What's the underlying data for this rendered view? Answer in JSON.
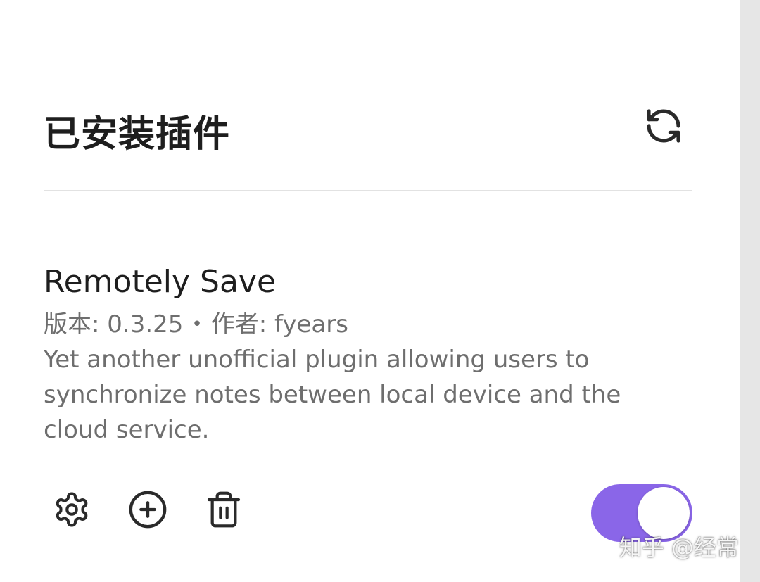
{
  "header": {
    "title": "已安装插件",
    "refresh_icon": "refresh-icon"
  },
  "plugin": {
    "name": "Remotely Save",
    "version_label": "版本: 0.3.25",
    "separator": "•",
    "author_label": "作者:  fyears",
    "description": "Yet another unofficial plugin allowing users to synchronize notes between local device and the cloud service.",
    "enabled": true,
    "actions": {
      "settings_icon": "gear-icon",
      "hotkeys_icon": "plus-circle-icon",
      "uninstall_icon": "trash-icon"
    }
  },
  "watermark": {
    "text": "知乎 @经常"
  },
  "colors": {
    "toggle_on": "#8a66e8",
    "title_text": "#1e1e1e",
    "muted_text": "#6e6e6e",
    "divider": "#e2e2e2",
    "scrollbar_track": "#e6e6e6"
  }
}
